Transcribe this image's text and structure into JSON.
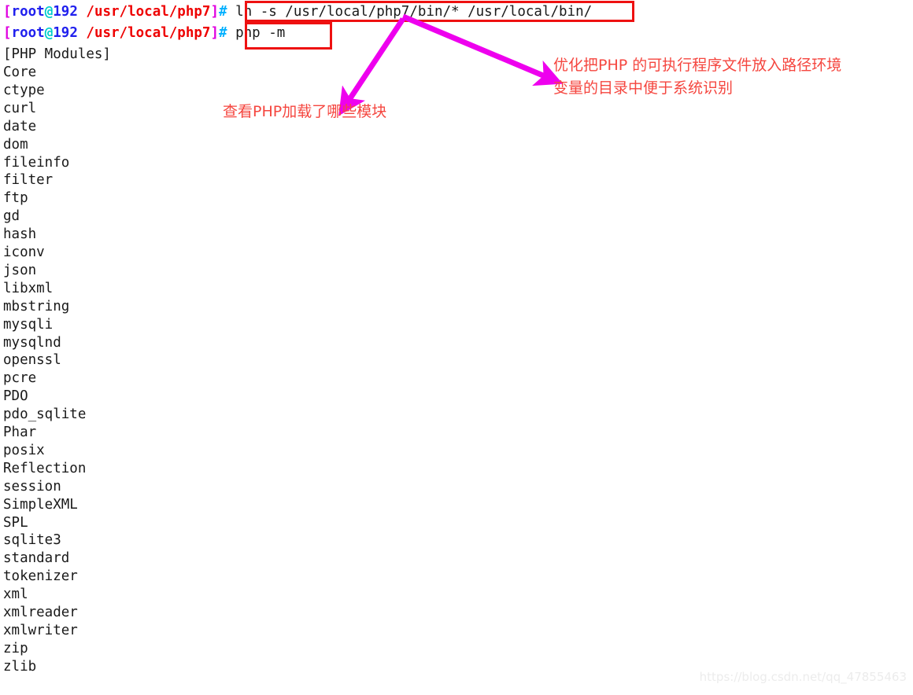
{
  "terminal": {
    "prompt": {
      "open_bracket": "[",
      "user": "root",
      "at": "@",
      "host": "192",
      "path": "/usr/local/php7",
      "close_bracket": "]",
      "hash": "#"
    },
    "commands": [
      "ln -s /usr/local/php7/bin/* /usr/local/bin/",
      "php -m"
    ],
    "output_header": "[PHP Modules]",
    "modules": [
      "Core",
      "ctype",
      "curl",
      "date",
      "dom",
      "fileinfo",
      "filter",
      "ftp",
      "gd",
      "hash",
      "iconv",
      "json",
      "libxml",
      "mbstring",
      "mysqli",
      "mysqlnd",
      "openssl",
      "pcre",
      "PDO",
      "pdo_sqlite",
      "Phar",
      "posix",
      "Reflection",
      "session",
      "SimpleXML",
      "SPL",
      "sqlite3",
      "standard",
      "tokenizer",
      "xml",
      "xmlreader",
      "xmlwriter",
      "zip",
      "zlib"
    ]
  },
  "annotations": {
    "note_right_line1": "优化把PHP 的可执行程序文件放入路径环境",
    "note_right_line2": "变量的目录中便于系统识别",
    "note_left": "查看PHP加载了哪些模块"
  },
  "colors": {
    "highlight_box": "#ee1111",
    "arrow": "#ee00ee",
    "note_text": "#f5463f",
    "prompt_bracket": "#e000e0",
    "prompt_user": "#2020ee",
    "prompt_at": "#00cccc",
    "prompt_path": "#ee0000",
    "prompt_hash": "#00b0ff"
  },
  "watermark": "https://blog.csdn.net/qq_47855463"
}
